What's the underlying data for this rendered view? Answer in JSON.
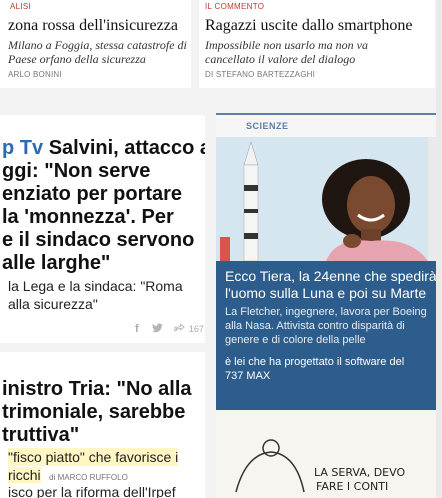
{
  "top_left": {
    "kicker": "ALISI",
    "title": "zona rossa dell'insicurezza",
    "subtitle_lines": [
      "Milano a Foggia, stessa catastrofe di",
      "Paese orfano della sicurezza"
    ],
    "byline": "ARLO BONINI"
  },
  "top_right": {
    "kicker": "IL COMMENTO",
    "title": "Ragazzi uscite dallo smartphone",
    "subtitle_lines": [
      "Impossibile non usarlo ma non va",
      "cancellato il valore del dialogo"
    ],
    "byline": "di STEFANO BARTEZZAGHI"
  },
  "main_story": {
    "tag": "p Tv",
    "title_lines": [
      "Salvini, attacco a",
      "ggi: \"Non serve",
      "enziato per portare",
      " la 'monnezza'. Per",
      "e il sindaco servono",
      "alle larghe\""
    ],
    "lead_lines": [
      "la Lega e la sindaca: \"Roma",
      "alla sicurezza\""
    ],
    "share_count": "167"
  },
  "second_story": {
    "title_lines": [
      "inistro Tria: \"No alla",
      "trimoniale, sarebbe",
      "truttiva\""
    ],
    "lead_lines": [
      "\"fisco piatto\" che favorisce i",
      "ricchi"
    ],
    "byline": "di MARCO RUFFOLO",
    "cut_line": "isco per la riforma dell'Irpef"
  },
  "science": {
    "section_label": "SCIENZE",
    "title_lines": [
      "Ecco Tiera, la 24enne che spedirà",
      "l'uomo sulla Luna e poi su Marte"
    ],
    "lead_lines": [
      "La Fletcher, ingegnere, lavora per Boeing",
      "alla Nasa. Attivista contro disparità di",
      "genere e di colore della pelle"
    ],
    "extra_lines": [
      "è lei che ha progettato il software del",
      "737 MAX"
    ]
  },
  "comic": {
    "lines": [
      "LA SERVA, DEVO",
      "FARE I CONTI"
    ]
  },
  "colors": {
    "accent_red": "#c0392b",
    "science_bg": "#2d5d8c",
    "science_label": "#5b7fa6"
  }
}
